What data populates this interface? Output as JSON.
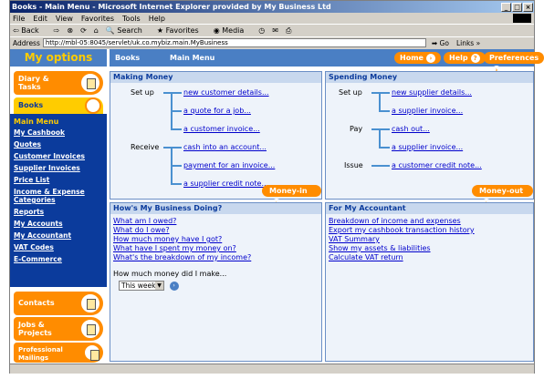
{
  "window": {
    "title": "Books - Main Menu - Microsoft Internet Explorer provided by My Business Ltd"
  },
  "menubar": [
    "File",
    "Edit",
    "View",
    "Favorites",
    "Tools",
    "Help"
  ],
  "toolbar": [
    "Back",
    "Search",
    "Favorites",
    "Media"
  ],
  "address": {
    "label": "Address",
    "url": "http://mbl-05:8045/servlet/uk.co.mybiz.main.MyBusiness",
    "go": "Go",
    "links": "Links »"
  },
  "sidebar": {
    "heading": "My options",
    "diary": "Diary & Tasks",
    "books": "Books",
    "main_menu": "Main Menu",
    "items": [
      "My Cashbook",
      "Quotes",
      "Customer Invoices",
      "Supplier Invoices",
      "Price List",
      "Income & Expense Categories",
      "Reports",
      "My Accounts",
      "My Accountant",
      "VAT Codes",
      "E-Commerce"
    ],
    "contacts": "Contacts",
    "jobs": "Jobs & Projects",
    "mailings": "Professional Mailings"
  },
  "topbar": {
    "tab1": "Books",
    "tab2": "Main Menu",
    "home": "Home",
    "help": "Help",
    "preferences": "Preferences"
  },
  "making_money": {
    "title": "Making Money",
    "setup_label": "Set up",
    "receive_label": "Receive",
    "links": [
      "new customer details...",
      "a quote for a job...",
      "a customer invoice...",
      "cash into an account...",
      "payment for an invoice...",
      "a supplier credit note..."
    ],
    "button": "Money-in"
  },
  "spending_money": {
    "title": "Spending Money",
    "setup_label": "Set up",
    "pay_label": "Pay",
    "issue_label": "Issue",
    "links": [
      "new supplier details...",
      "a supplier invoice...",
      "cash out...",
      "a supplier invoice...",
      "a customer credit note..."
    ],
    "button": "Money-out"
  },
  "business": {
    "title": "How's My Business Doing?",
    "links": [
      "What am I owed?",
      "What do I owe?",
      "How much money have I got?",
      "What have I spent my money on?",
      "What's the breakdown of my income?"
    ],
    "question": "How much money did I make...",
    "period": "This week"
  },
  "accountant": {
    "title": "For My Accountant",
    "links": [
      "Breakdown of income and expenses",
      "Export my cashbook transaction history",
      "VAT Summary",
      "Show my assets & liabilities",
      "Calculate VAT return"
    ]
  }
}
